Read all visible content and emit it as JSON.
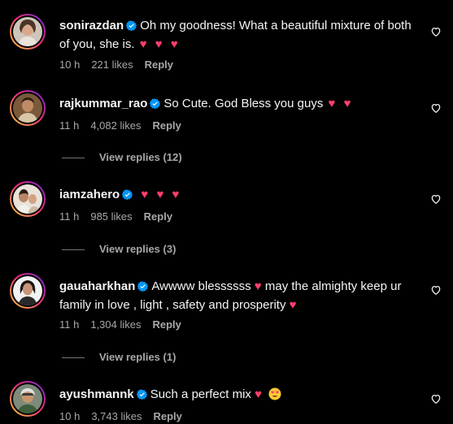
{
  "comments": [
    {
      "username": "sonirazdan",
      "text": "Oh my goodness! What a beautiful mixture of both of you, she is.",
      "emojis": "♥ ♥ ♥",
      "time": "10 h",
      "likes": "221 likes",
      "reply": "Reply",
      "view_replies": ""
    },
    {
      "username": "rajkummar_rao",
      "text": "So Cute. God Bless you guys",
      "emojis": "♥ ♥",
      "time": "11 h",
      "likes": "4,082 likes",
      "reply": "Reply",
      "view_replies": "View replies (12)"
    },
    {
      "username": "iamzahero",
      "text": "",
      "emojis": "♥ ♥ ♥",
      "time": "11 h",
      "likes": "985 likes",
      "reply": "Reply",
      "view_replies": "View replies (3)"
    },
    {
      "username": "gauaharkhan",
      "text_a": "Awwww blessssss",
      "emoji_a": "♥",
      "text_b": "may the almighty keep ur family in love , light , safety and prosperity",
      "emoji_b": "♥",
      "time": "11 h",
      "likes": "1,304 likes",
      "reply": "Reply",
      "view_replies": "View replies (1)"
    },
    {
      "username": "ayushmannk",
      "text": "Such a perfect mix",
      "emojis": "♥",
      "emoji_face": "😍",
      "time": "10 h",
      "likes": "3,743 likes",
      "reply": "Reply",
      "view_replies": ""
    }
  ],
  "colors": {
    "background": "#000000",
    "text": "#f5f5f5",
    "secondary": "#a8a8a8",
    "verified": "#0095f6",
    "heart_emoji": "#ff3e6c"
  },
  "icons": {
    "verified": "verified-badge-icon",
    "like": "heart-outline-icon"
  }
}
